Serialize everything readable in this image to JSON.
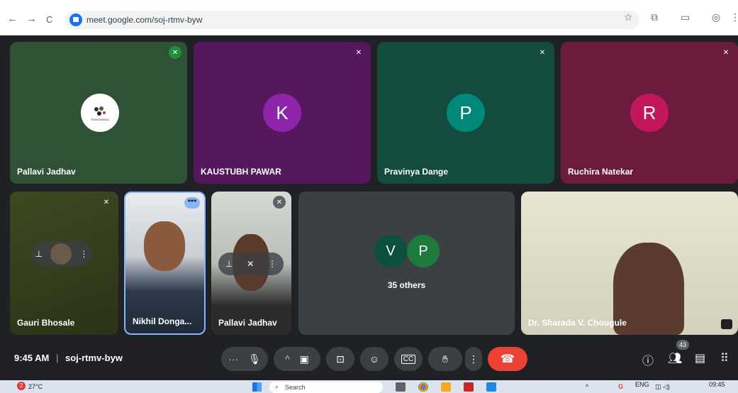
{
  "browser": {
    "url": "meet.google.com/soj-rtmv-byw",
    "back": "←",
    "forward": "→",
    "reload": "C"
  },
  "tiles": [
    {
      "name": "Pallavi Jadhav",
      "bg": "#2f5236",
      "logo_text": "TEKNOMINDZ"
    },
    {
      "name": "KAUSTUBH PAWAR",
      "bg": "#55185d",
      "initial": "K",
      "avatar_color": "#8e24aa"
    },
    {
      "name": "Pravinya Dange",
      "bg": "#134b3f",
      "initial": "P",
      "avatar_color": "#00897b"
    },
    {
      "name": "Ruchira Natekar",
      "bg": "#6d1b3d",
      "initial": "R",
      "avatar_color": "#c2185b"
    },
    {
      "name": "Gauri Bhosale",
      "bg": "#3c4a22"
    },
    {
      "name": "Nikhil Donga..."
    },
    {
      "name": "Pallavi Jadhav"
    },
    {
      "others_label": "35 others",
      "initials": [
        "V",
        "P"
      ]
    },
    {
      "name": "Dr. Sharada V. Chougule"
    }
  ],
  "bar": {
    "time": "9:45 AM",
    "separator": "|",
    "meeting_code": "soj-rtmv-byw",
    "people_count": "43"
  },
  "taskbar": {
    "weather": "27°C",
    "weather_badge": "2",
    "search_placeholder": "Search",
    "lang": "ENG",
    "clock": "09:45"
  },
  "colors": {
    "meet_blue": "#1a73e8",
    "end_call": "#ea4335",
    "bar_bg": "#202124"
  }
}
